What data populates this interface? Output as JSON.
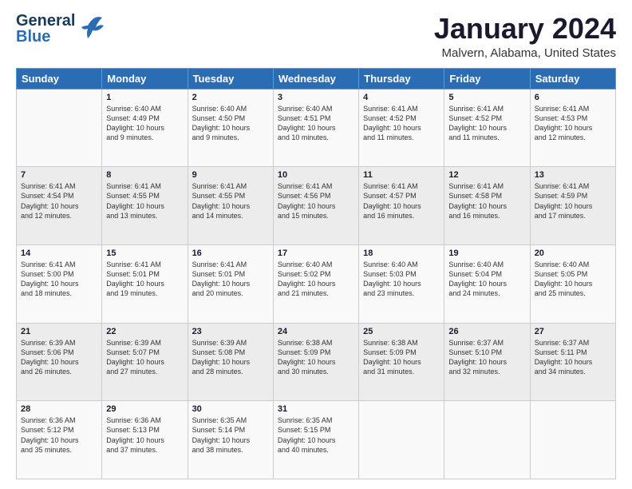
{
  "header": {
    "logo_line1": "General",
    "logo_line2": "Blue",
    "month_title": "January 2024",
    "location": "Malvern, Alabama, United States"
  },
  "weekdays": [
    "Sunday",
    "Monday",
    "Tuesday",
    "Wednesday",
    "Thursday",
    "Friday",
    "Saturday"
  ],
  "weeks": [
    [
      {
        "day": "",
        "info": ""
      },
      {
        "day": "1",
        "info": "Sunrise: 6:40 AM\nSunset: 4:49 PM\nDaylight: 10 hours\nand 9 minutes."
      },
      {
        "day": "2",
        "info": "Sunrise: 6:40 AM\nSunset: 4:50 PM\nDaylight: 10 hours\nand 9 minutes."
      },
      {
        "day": "3",
        "info": "Sunrise: 6:40 AM\nSunset: 4:51 PM\nDaylight: 10 hours\nand 10 minutes."
      },
      {
        "day": "4",
        "info": "Sunrise: 6:41 AM\nSunset: 4:52 PM\nDaylight: 10 hours\nand 11 minutes."
      },
      {
        "day": "5",
        "info": "Sunrise: 6:41 AM\nSunset: 4:52 PM\nDaylight: 10 hours\nand 11 minutes."
      },
      {
        "day": "6",
        "info": "Sunrise: 6:41 AM\nSunset: 4:53 PM\nDaylight: 10 hours\nand 12 minutes."
      }
    ],
    [
      {
        "day": "7",
        "info": "Sunrise: 6:41 AM\nSunset: 4:54 PM\nDaylight: 10 hours\nand 12 minutes."
      },
      {
        "day": "8",
        "info": "Sunrise: 6:41 AM\nSunset: 4:55 PM\nDaylight: 10 hours\nand 13 minutes."
      },
      {
        "day": "9",
        "info": "Sunrise: 6:41 AM\nSunset: 4:55 PM\nDaylight: 10 hours\nand 14 minutes."
      },
      {
        "day": "10",
        "info": "Sunrise: 6:41 AM\nSunset: 4:56 PM\nDaylight: 10 hours\nand 15 minutes."
      },
      {
        "day": "11",
        "info": "Sunrise: 6:41 AM\nSunset: 4:57 PM\nDaylight: 10 hours\nand 16 minutes."
      },
      {
        "day": "12",
        "info": "Sunrise: 6:41 AM\nSunset: 4:58 PM\nDaylight: 10 hours\nand 16 minutes."
      },
      {
        "day": "13",
        "info": "Sunrise: 6:41 AM\nSunset: 4:59 PM\nDaylight: 10 hours\nand 17 minutes."
      }
    ],
    [
      {
        "day": "14",
        "info": "Sunrise: 6:41 AM\nSunset: 5:00 PM\nDaylight: 10 hours\nand 18 minutes."
      },
      {
        "day": "15",
        "info": "Sunrise: 6:41 AM\nSunset: 5:01 PM\nDaylight: 10 hours\nand 19 minutes."
      },
      {
        "day": "16",
        "info": "Sunrise: 6:41 AM\nSunset: 5:01 PM\nDaylight: 10 hours\nand 20 minutes."
      },
      {
        "day": "17",
        "info": "Sunrise: 6:40 AM\nSunset: 5:02 PM\nDaylight: 10 hours\nand 21 minutes."
      },
      {
        "day": "18",
        "info": "Sunrise: 6:40 AM\nSunset: 5:03 PM\nDaylight: 10 hours\nand 23 minutes."
      },
      {
        "day": "19",
        "info": "Sunrise: 6:40 AM\nSunset: 5:04 PM\nDaylight: 10 hours\nand 24 minutes."
      },
      {
        "day": "20",
        "info": "Sunrise: 6:40 AM\nSunset: 5:05 PM\nDaylight: 10 hours\nand 25 minutes."
      }
    ],
    [
      {
        "day": "21",
        "info": "Sunrise: 6:39 AM\nSunset: 5:06 PM\nDaylight: 10 hours\nand 26 minutes."
      },
      {
        "day": "22",
        "info": "Sunrise: 6:39 AM\nSunset: 5:07 PM\nDaylight: 10 hours\nand 27 minutes."
      },
      {
        "day": "23",
        "info": "Sunrise: 6:39 AM\nSunset: 5:08 PM\nDaylight: 10 hours\nand 28 minutes."
      },
      {
        "day": "24",
        "info": "Sunrise: 6:38 AM\nSunset: 5:09 PM\nDaylight: 10 hours\nand 30 minutes."
      },
      {
        "day": "25",
        "info": "Sunrise: 6:38 AM\nSunset: 5:09 PM\nDaylight: 10 hours\nand 31 minutes."
      },
      {
        "day": "26",
        "info": "Sunrise: 6:37 AM\nSunset: 5:10 PM\nDaylight: 10 hours\nand 32 minutes."
      },
      {
        "day": "27",
        "info": "Sunrise: 6:37 AM\nSunset: 5:11 PM\nDaylight: 10 hours\nand 34 minutes."
      }
    ],
    [
      {
        "day": "28",
        "info": "Sunrise: 6:36 AM\nSunset: 5:12 PM\nDaylight: 10 hours\nand 35 minutes."
      },
      {
        "day": "29",
        "info": "Sunrise: 6:36 AM\nSunset: 5:13 PM\nDaylight: 10 hours\nand 37 minutes."
      },
      {
        "day": "30",
        "info": "Sunrise: 6:35 AM\nSunset: 5:14 PM\nDaylight: 10 hours\nand 38 minutes."
      },
      {
        "day": "31",
        "info": "Sunrise: 6:35 AM\nSunset: 5:15 PM\nDaylight: 10 hours\nand 40 minutes."
      },
      {
        "day": "",
        "info": ""
      },
      {
        "day": "",
        "info": ""
      },
      {
        "day": "",
        "info": ""
      }
    ]
  ]
}
